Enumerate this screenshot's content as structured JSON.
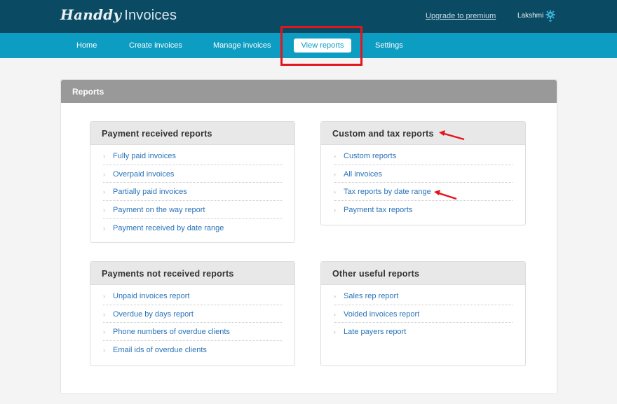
{
  "header": {
    "logo_script": "Handdy",
    "logo_plain": "Invoices",
    "upgrade_link": "Upgrade to premium",
    "user_name": "Lakshmi"
  },
  "nav": {
    "home": "Home",
    "create": "Create invoices",
    "manage": "Manage invoices",
    "view": "View reports",
    "settings": "Settings"
  },
  "panel": {
    "title": "Reports"
  },
  "sections": {
    "payment_received": {
      "title": "Payment received reports",
      "items": [
        "Fully paid invoices",
        "Overpaid invoices",
        "Partially paid invoices",
        "Payment on the way report",
        "Payment received by date range"
      ]
    },
    "custom_tax": {
      "title": "Custom and tax reports",
      "items": [
        "Custom reports",
        "All invoices",
        "Tax reports by date range",
        "Payment tax reports"
      ]
    },
    "not_received": {
      "title": "Payments not received reports",
      "items": [
        "Unpaid invoices report",
        "Overdue by days report",
        "Phone numbers of overdue clients",
        "Email ids of overdue clients"
      ]
    },
    "other": {
      "title": "Other useful reports",
      "items": [
        "Sales rep report",
        "Voided invoices report",
        "Late payers report"
      ]
    }
  },
  "colors": {
    "topbar": "#0b4a63",
    "navbar": "#0d9cc2",
    "link": "#2a73b8",
    "annotation_red": "#e3161c"
  }
}
